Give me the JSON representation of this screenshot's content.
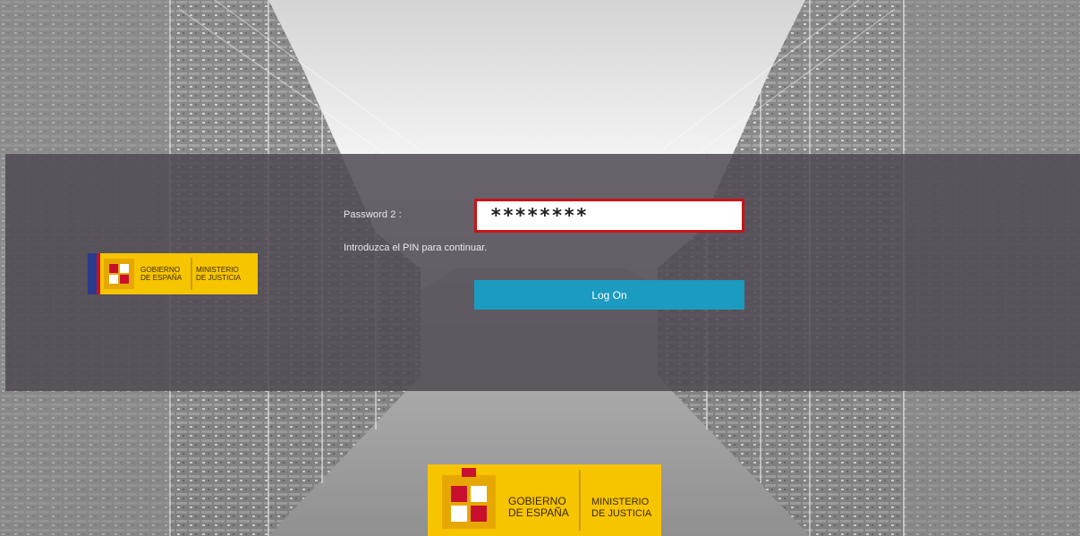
{
  "login": {
    "password_label": "Password 2 :",
    "password_value": "********",
    "hint": "Introduzca el PIN para continuar.",
    "logon_label": "Log On"
  },
  "logo": {
    "line1": "GOBIERNO",
    "line2": "DE ESPAÑA",
    "line3": "MINISTERIO",
    "line4": "DE JUSTICIA"
  },
  "colors": {
    "band": "#504954",
    "input_border": "#c71418",
    "button": "#1a9bbf",
    "logo_yellow": "#f7c400",
    "logo_red": "#c8102e"
  },
  "icons": [
    "coat-of-arms-icon",
    "eu-flag-strip-icon"
  ]
}
